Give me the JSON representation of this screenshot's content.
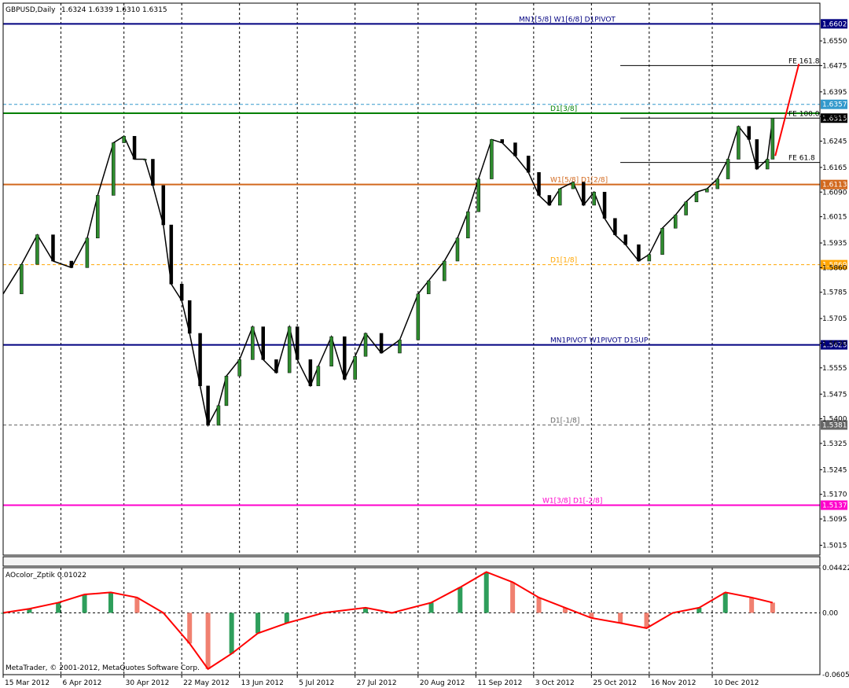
{
  "header": {
    "symbol_tf": "GBPUSD,Daily",
    "ohlc": "1.6324 1.6339 1.6310 1.6315"
  },
  "copyright": "MetaTrader, © 2001-2012, MetaQuotes Software Corp.",
  "chart_data": [
    {
      "type": "candlestick",
      "title": "GBPUSD,Daily",
      "ylim": [
        1.4985,
        1.6665
      ],
      "x_start": "2012-03-15",
      "x_end": "2013-01-20",
      "price_ticks": [
        "1.6550",
        "1.6475",
        "1.6395",
        "1.6320",
        "1.6245",
        "1.6165",
        "1.6090",
        "1.6015",
        "1.5935",
        "1.5860",
        "1.5785",
        "1.5705",
        "1.5630",
        "1.5555",
        "1.5475",
        "1.5400",
        "1.5325",
        "1.5245",
        "1.5170",
        "1.5095",
        "1.5015"
      ],
      "date_ticks": [
        {
          "date": "2012-03-15",
          "label": "15 Mar 2012"
        },
        {
          "date": "2012-04-06",
          "label": "6 Apr 2012"
        },
        {
          "date": "2012-04-30",
          "label": "30 Apr 2012"
        },
        {
          "date": "2012-05-22",
          "label": "22 May 2012"
        },
        {
          "date": "2012-06-13",
          "label": "13 Jun 2012"
        },
        {
          "date": "2012-07-05",
          "label": "5 Jul 2012"
        },
        {
          "date": "2012-07-27",
          "label": "27 Jul 2012"
        },
        {
          "date": "2012-08-20",
          "label": "20 Aug 2012"
        },
        {
          "date": "2012-09-11",
          "label": "11 Sep 2012"
        },
        {
          "date": "2012-10-03",
          "label": "3 Oct 2012"
        },
        {
          "date": "2012-10-25",
          "label": "25 Oct 2012"
        },
        {
          "date": "2012-11-16",
          "label": "16 Nov 2012"
        },
        {
          "date": "2012-12-10",
          "label": "10 Dec 2012"
        }
      ],
      "grid": true,
      "price_path": [
        [
          "2012-03-15",
          1.578
        ],
        [
          "2012-03-22",
          1.587
        ],
        [
          "2012-03-28",
          1.596
        ],
        [
          "2012-04-03",
          1.588
        ],
        [
          "2012-04-10",
          1.586
        ],
        [
          "2012-04-16",
          1.595
        ],
        [
          "2012-04-20",
          1.608
        ],
        [
          "2012-04-26",
          1.624
        ],
        [
          "2012-04-30",
          1.626
        ],
        [
          "2012-05-04",
          1.619
        ],
        [
          "2012-05-08",
          1.619
        ],
        [
          "2012-05-11",
          1.611
        ],
        [
          "2012-05-15",
          1.599
        ],
        [
          "2012-05-18",
          1.581
        ],
        [
          "2012-05-22",
          1.576
        ],
        [
          "2012-05-25",
          1.566
        ],
        [
          "2012-05-29",
          1.55
        ],
        [
          "2012-06-01",
          1.538
        ],
        [
          "2012-06-05",
          1.544
        ],
        [
          "2012-06-08",
          1.553
        ],
        [
          "2012-06-13",
          1.558
        ],
        [
          "2012-06-18",
          1.568
        ],
        [
          "2012-06-22",
          1.558
        ],
        [
          "2012-06-27",
          1.554
        ],
        [
          "2012-07-02",
          1.568
        ],
        [
          "2012-07-05",
          1.558
        ],
        [
          "2012-07-10",
          1.55
        ],
        [
          "2012-07-13",
          1.556
        ],
        [
          "2012-07-18",
          1.565
        ],
        [
          "2012-07-23",
          1.552
        ],
        [
          "2012-07-27",
          1.559
        ],
        [
          "2012-07-31",
          1.566
        ],
        [
          "2012-08-06",
          1.56
        ],
        [
          "2012-08-13",
          1.564
        ],
        [
          "2012-08-20",
          1.578
        ],
        [
          "2012-08-24",
          1.582
        ],
        [
          "2012-08-30",
          1.588
        ],
        [
          "2012-09-04",
          1.595
        ],
        [
          "2012-09-08",
          1.603
        ],
        [
          "2012-09-12",
          1.613
        ],
        [
          "2012-09-17",
          1.625
        ],
        [
          "2012-09-21",
          1.624
        ],
        [
          "2012-09-26",
          1.62
        ],
        [
          "2012-10-01",
          1.615
        ],
        [
          "2012-10-05",
          1.608
        ],
        [
          "2012-10-09",
          1.605
        ],
        [
          "2012-10-13",
          1.61
        ],
        [
          "2012-10-18",
          1.612
        ],
        [
          "2012-10-22",
          1.605
        ],
        [
          "2012-10-26",
          1.609
        ],
        [
          "2012-10-30",
          1.601
        ],
        [
          "2012-11-03",
          1.596
        ],
        [
          "2012-11-07",
          1.593
        ],
        [
          "2012-11-12",
          1.588
        ],
        [
          "2012-11-16",
          1.59
        ],
        [
          "2012-11-21",
          1.598
        ],
        [
          "2012-11-26",
          1.602
        ],
        [
          "2012-11-30",
          1.606
        ],
        [
          "2012-12-04",
          1.609
        ],
        [
          "2012-12-08",
          1.61
        ],
        [
          "2012-12-12",
          1.613
        ],
        [
          "2012-12-16",
          1.619
        ],
        [
          "2012-12-20",
          1.629
        ],
        [
          "2012-12-24",
          1.625
        ],
        [
          "2012-12-27",
          1.616
        ],
        [
          "2012-12-31",
          1.619
        ],
        [
          "2013-01-02",
          1.6315
        ]
      ],
      "projection": [
        [
          "2013-01-03",
          1.62
        ],
        [
          "2013-01-12",
          1.648
        ]
      ],
      "horizontal_levels": [
        {
          "name": "MN1[5/8] W1[6/8] D1PIVOT",
          "price": 1.6602,
          "color": "#000080",
          "style": "solid",
          "badge": "1.6602"
        },
        {
          "name": "FE 161.8",
          "price": 1.6475,
          "color": "#000000",
          "style": "solid",
          "segment": [
            "2012-11-05",
            "2013-01-20"
          ]
        },
        {
          "name": "",
          "price": 1.6357,
          "color": "#3399cc",
          "style": "dashed",
          "badge": "1.6357"
        },
        {
          "name": "D1[3/8]",
          "price": 1.633,
          "color": "#008000",
          "style": "solid"
        },
        {
          "name": "FE 100.0",
          "price": 1.6315,
          "color": "#000000",
          "style": "solid",
          "badge": "1.6315",
          "segment": [
            "2012-11-05",
            "2013-01-20"
          ]
        },
        {
          "name": "FE 61.8",
          "price": 1.618,
          "color": "#000000",
          "style": "solid",
          "segment": [
            "2012-11-05",
            "2013-01-20"
          ]
        },
        {
          "name": "W1[5/8] D1[2/8]",
          "price": 1.6113,
          "color": "#d2691e",
          "style": "solid",
          "badge": "1.6113"
        },
        {
          "name": "D1[1/8]",
          "price": 1.5869,
          "color": "#ffa500",
          "style": "dashed",
          "badge": "1.5869"
        },
        {
          "name": "MN1PIVOT W1PIVOT D1SUP",
          "price": 1.5625,
          "color": "#000080",
          "style": "solid",
          "badge": "1.5625"
        },
        {
          "name": "D1[-1/8]",
          "price": 1.5381,
          "color": "#666666",
          "style": "dashed",
          "badge": "1.5381"
        },
        {
          "name": "W1[3/8] D1[-2/8]",
          "price": 1.5137,
          "color": "#ff00cc",
          "style": "solid",
          "badge": "1.5137"
        }
      ]
    },
    {
      "type": "histogram",
      "title": "AOcolor_Zptik 0.01022",
      "ylim": [
        -0.0605,
        0.0442
      ],
      "ticks": [
        "0.04422",
        "0.00",
        "-0.06053"
      ],
      "series_path": [
        [
          "2012-03-15",
          0.0
        ],
        [
          "2012-03-25",
          0.004
        ],
        [
          "2012-04-05",
          0.01
        ],
        [
          "2012-04-15",
          0.018
        ],
        [
          "2012-04-25",
          0.02
        ],
        [
          "2012-05-05",
          0.015
        ],
        [
          "2012-05-15",
          0.0
        ],
        [
          "2012-05-25",
          -0.03
        ],
        [
          "2012-06-01",
          -0.055
        ],
        [
          "2012-06-10",
          -0.04
        ],
        [
          "2012-06-20",
          -0.02
        ],
        [
          "2012-07-01",
          -0.01
        ],
        [
          "2012-07-15",
          0.0
        ],
        [
          "2012-07-31",
          0.005
        ],
        [
          "2012-08-10",
          0.0
        ],
        [
          "2012-08-25",
          0.01
        ],
        [
          "2012-09-05",
          0.025
        ],
        [
          "2012-09-15",
          0.04
        ],
        [
          "2012-09-25",
          0.03
        ],
        [
          "2012-10-05",
          0.015
        ],
        [
          "2012-10-15",
          0.005
        ],
        [
          "2012-10-25",
          -0.005
        ],
        [
          "2012-11-05",
          -0.01
        ],
        [
          "2012-11-15",
          -0.015
        ],
        [
          "2012-11-25",
          0.0
        ],
        [
          "2012-12-05",
          0.005
        ],
        [
          "2012-12-15",
          0.02
        ],
        [
          "2012-12-25",
          0.015
        ],
        [
          "2013-01-02",
          0.01
        ]
      ]
    }
  ]
}
